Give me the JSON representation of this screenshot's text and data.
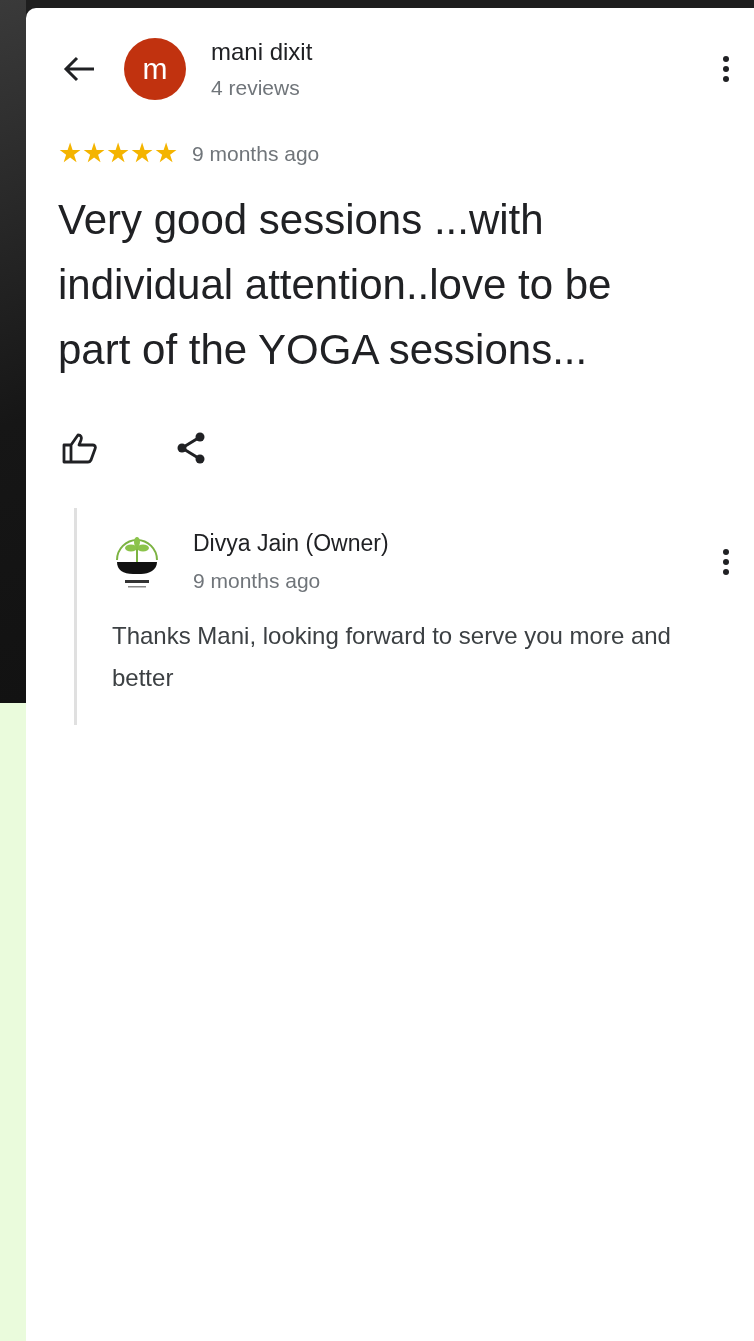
{
  "review": {
    "author": "mani dixit",
    "author_initial": "m",
    "review_count": "4 reviews",
    "stars": 5,
    "time": "9 months ago",
    "text": "Very good sessions ...with individual attention..love to be part of the YOGA sessions..."
  },
  "reply": {
    "author": "Divya Jain (Owner)",
    "time": "9 months ago",
    "text": "Thanks Mani, looking forward to serve you more and better"
  }
}
